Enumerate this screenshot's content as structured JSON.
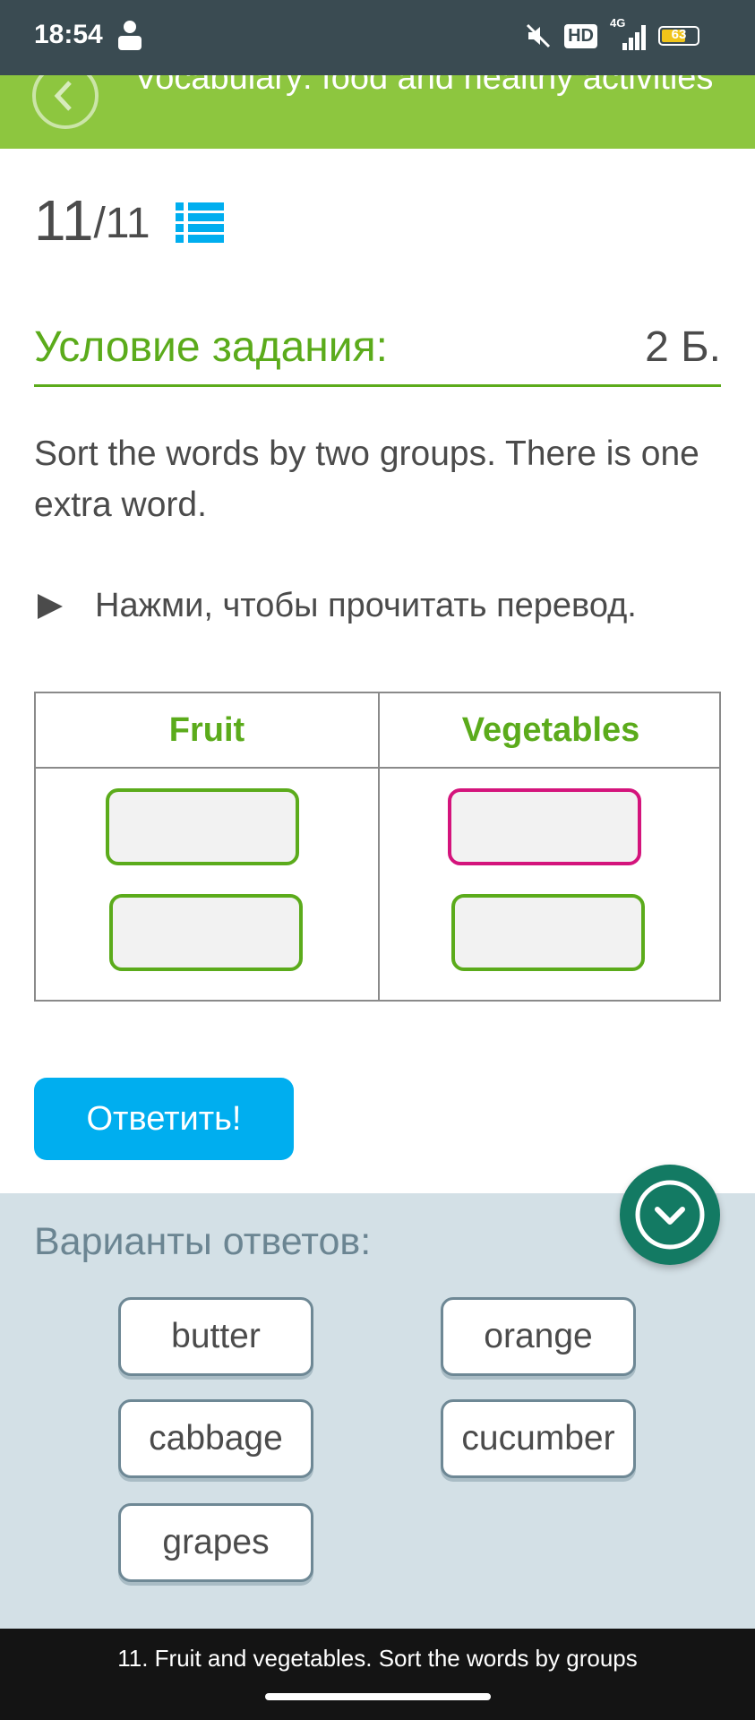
{
  "status_bar": {
    "time": "18:54",
    "network_badge": "HD",
    "network_type": "4G",
    "battery_level": "63"
  },
  "header": {
    "title": "Vocabulary: food and healthy activities"
  },
  "progress": {
    "current": "11",
    "total": "/11"
  },
  "task": {
    "label": "Условие задания:",
    "points": "2 Б.",
    "instruction": "Sort the words by two groups. There is one extra word.",
    "translation_toggle": "Нажми, чтобы прочитать перевод."
  },
  "table": {
    "columns": [
      "Fruit",
      "Vegetables"
    ]
  },
  "answer_button": "Ответить!",
  "options": {
    "title": "Варианты ответов:",
    "words": [
      "butter",
      "orange",
      "cabbage",
      "cucumber",
      "grapes"
    ]
  },
  "caption": "11. Fruit and vegetables. Sort the words by groups",
  "colors": {
    "header_green": "#8dc63f",
    "accent_green": "#5bab1b",
    "answer_blue": "#00aeef",
    "active_slot_pink": "#d4147c",
    "fab_teal": "#137a63",
    "options_panel": "#d3e0e6"
  }
}
